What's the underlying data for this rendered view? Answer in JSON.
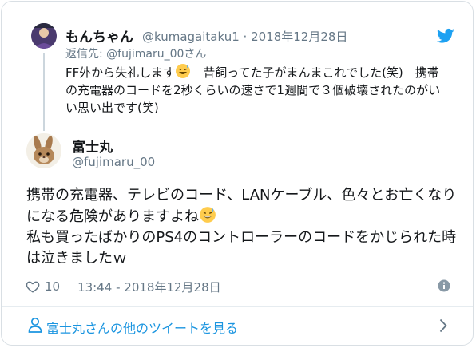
{
  "parent_tweet": {
    "name": "もんちゃん",
    "handle": "@kumagaitaku1 · 2018年12月28日",
    "reply_to": "返信先: @fujimaru_00さん",
    "text_part1": "FF外から失礼します",
    "text_part2": "　昔飼ってた子がまんまこれでした(笑)　携帯の充電器のコードを2秒くらいの速さで1週間で３個破壊されたのがいい思い出です(笑)"
  },
  "main_tweet": {
    "name": "富士丸",
    "handle": "@fujimaru_00",
    "text_part1": "携帯の充電器、テレビのコード、LANケーブル、色々とお亡くなりになる危険がありますよね",
    "text_part2": "\n私も買ったばかりのPS4のコントローラーのコードをかじられた時は泣きましたｗ",
    "likes": "10",
    "timestamp": "13:44 - 2018年12月28日"
  },
  "footer": {
    "label": "富士丸さんの他のツイートを見る"
  },
  "icons": {
    "bird": "twitter-bird-icon",
    "heart": "heart-icon",
    "info": "info-icon",
    "person": "person-icon",
    "chevron": "chevron-right-icon",
    "emoji": "grinning-sweat-emoji"
  },
  "colors": {
    "brand_blue": "#1da1f2",
    "link_blue": "#1b95e0",
    "muted": "#657786",
    "text": "#14171a"
  }
}
